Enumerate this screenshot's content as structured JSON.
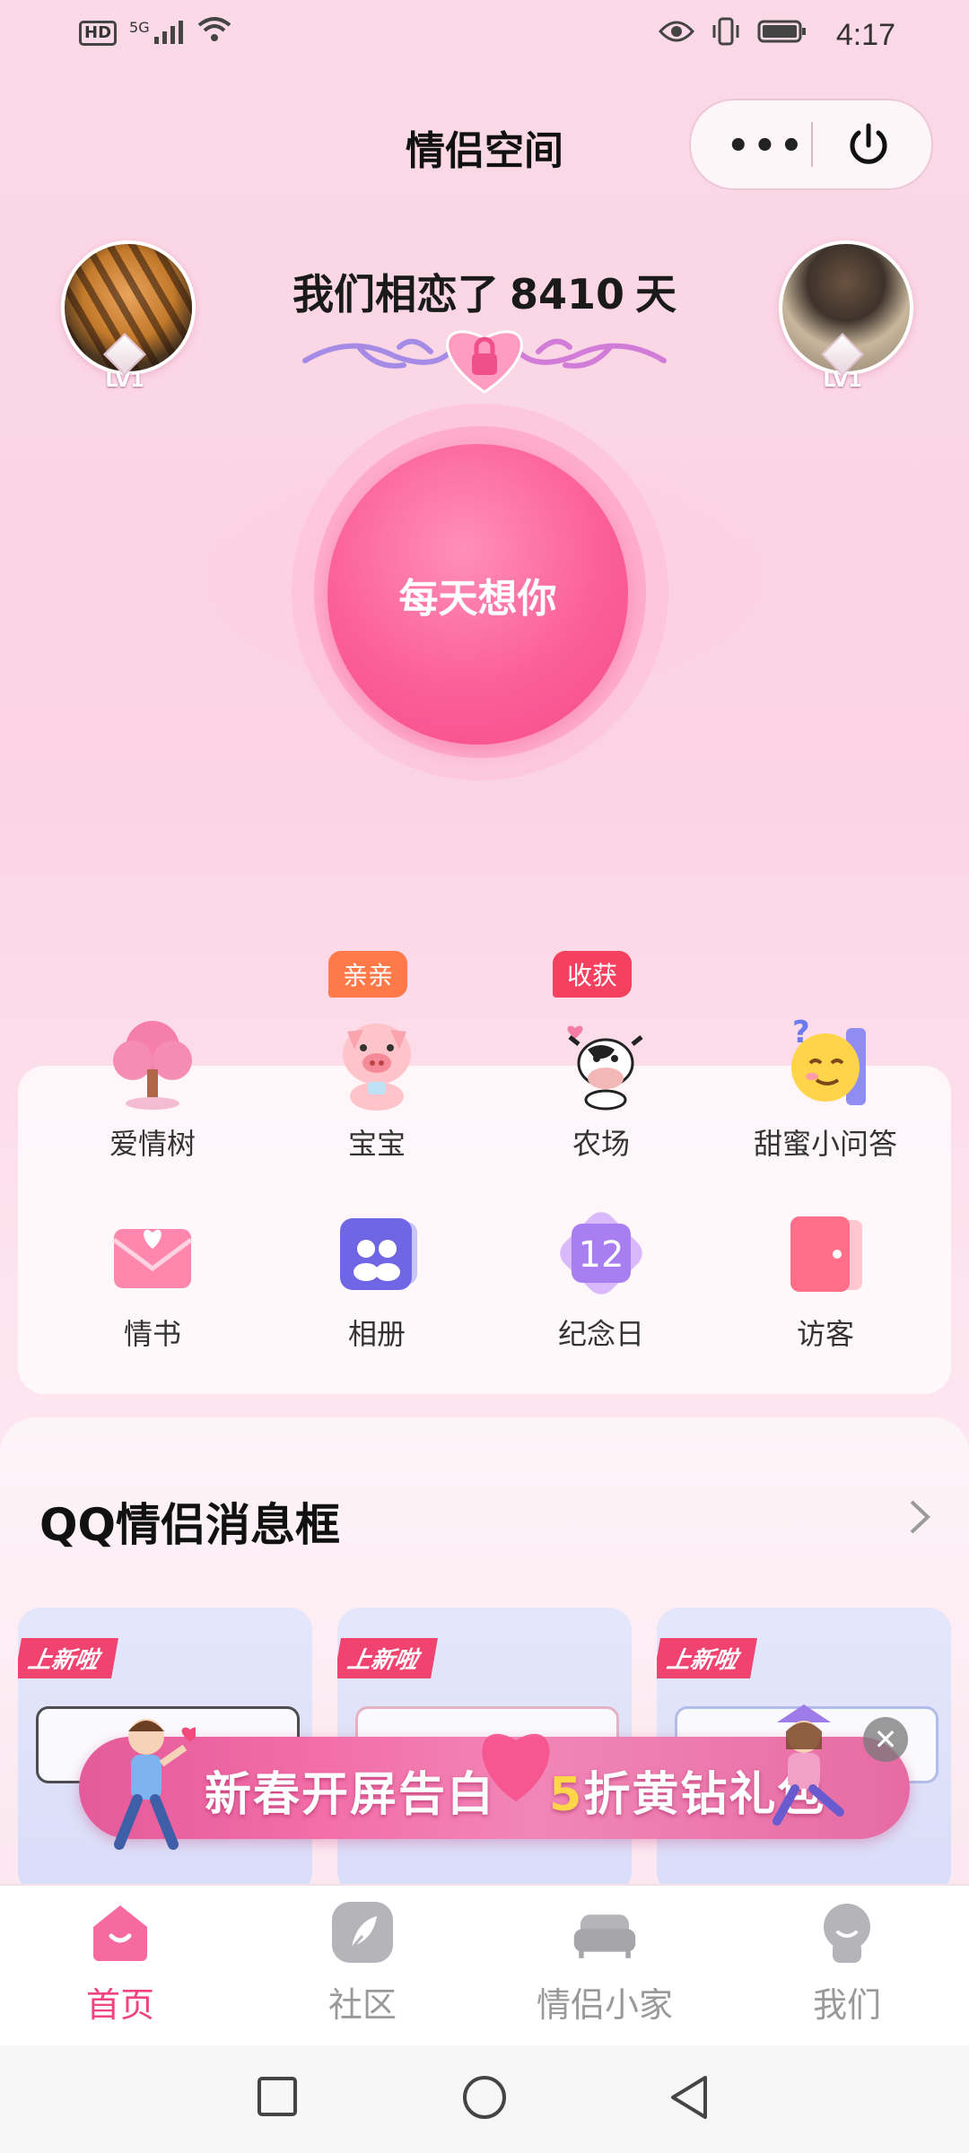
{
  "status_bar": {
    "time": "4:17",
    "network": "5G",
    "hd": "HD"
  },
  "header": {
    "title": "情侣空间",
    "more_icon": "more-dots-icon",
    "power_icon": "power-icon"
  },
  "couple": {
    "prefix": "我们相恋了",
    "days": "8410",
    "suffix": "天",
    "left_level": "LV1",
    "right_level": "LV1"
  },
  "main_button": {
    "label": "每天想你"
  },
  "features": [
    {
      "label": "爱情树",
      "icon": "love-tree-icon"
    },
    {
      "label": "宝宝",
      "icon": "baby-pig-icon",
      "tag": "亲亲"
    },
    {
      "label": "农场",
      "icon": "farm-cow-icon",
      "tag": "收获"
    },
    {
      "label": "甜蜜小问答",
      "icon": "sweet-quiz-icon"
    },
    {
      "label": "情书",
      "icon": "love-letter-icon"
    },
    {
      "label": "相册",
      "icon": "album-icon"
    },
    {
      "label": "纪念日",
      "icon": "anniversary-icon",
      "badge": "12"
    },
    {
      "label": "访客",
      "icon": "visitor-icon"
    }
  ],
  "section": {
    "title": "QQ情侣消息框"
  },
  "cards": [
    {
      "tag": "上新啦"
    },
    {
      "tag": "上新啦"
    },
    {
      "tag": "上新啦"
    }
  ],
  "banner": {
    "part1": "新春开屏告白",
    "highlight": "5",
    "part2": "折黄钻礼包"
  },
  "bottom_nav": [
    {
      "label": "首页",
      "icon": "home-icon",
      "active": true
    },
    {
      "label": "社区",
      "icon": "community-icon"
    },
    {
      "label": "情侣小家",
      "icon": "couple-home-icon"
    },
    {
      "label": "我们",
      "icon": "us-icon"
    }
  ],
  "colors": {
    "accent": "#f0437f",
    "button": "#fb5f98",
    "tag_orange": "#ff7a48",
    "tag_red": "#f5405f"
  }
}
